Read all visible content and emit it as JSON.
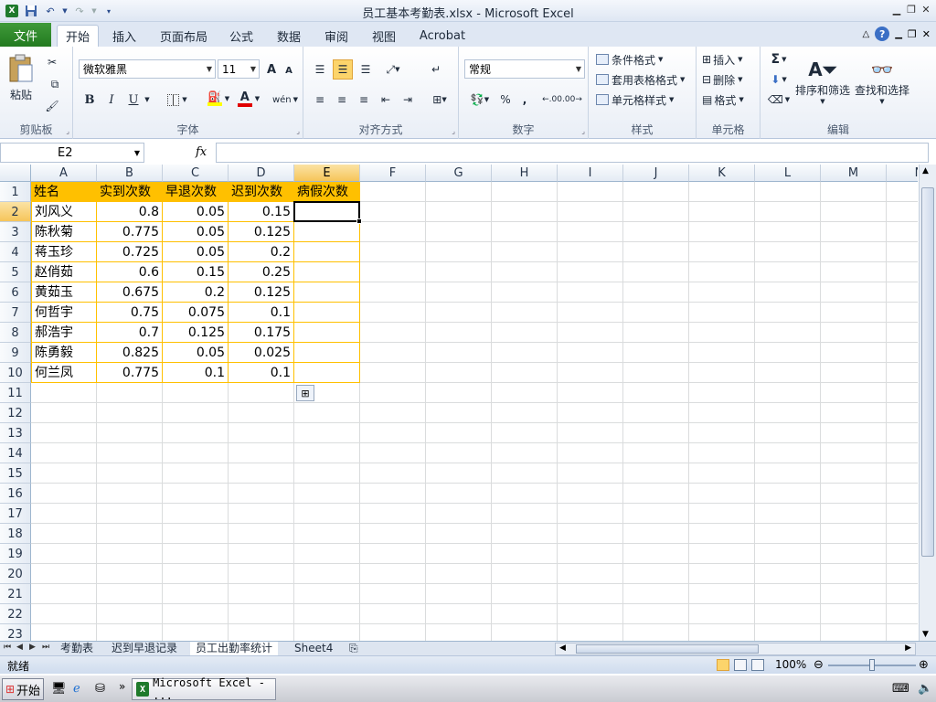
{
  "window": {
    "title": "员工基本考勤表.xlsx - Microsoft Excel"
  },
  "ribbon_tabs": [
    "文件",
    "开始",
    "插入",
    "页面布局",
    "公式",
    "数据",
    "审阅",
    "视图",
    "Acrobat"
  ],
  "ribbon": {
    "clipboard": {
      "paste": "粘贴",
      "group": "剪贴板"
    },
    "font": {
      "name": "微软雅黑",
      "size": "11",
      "bold": "B",
      "italic": "I",
      "underline": "U",
      "group": "字体",
      "grow": "A",
      "shrink": "A"
    },
    "alignment": {
      "group": "对齐方式"
    },
    "number": {
      "format": "常规",
      "percent": "%",
      "comma": ",",
      "inc_decimal": ".00",
      "dec_decimal": ".00",
      "group": "数字"
    },
    "styles": {
      "conditional": "条件格式",
      "table": "套用表格格式",
      "cell_styles": "单元格样式",
      "group": "样式"
    },
    "cells": {
      "insert": "插入",
      "delete": "删除",
      "format": "格式",
      "group": "单元格"
    },
    "editing": {
      "sum": "Σ",
      "sort": "排序和筛选",
      "find": "查找和选择",
      "group": "编辑"
    }
  },
  "formula_bar": {
    "name_box": "E2",
    "fx": "fx",
    "value": ""
  },
  "columns": [
    "A",
    "B",
    "C",
    "D",
    "E",
    "F",
    "G",
    "H",
    "I",
    "J",
    "K",
    "L",
    "M",
    "N"
  ],
  "rows": [
    "1",
    "2",
    "3",
    "4",
    "5",
    "6",
    "7",
    "8",
    "9",
    "10",
    "11",
    "12",
    "13",
    "14",
    "15",
    "16",
    "17",
    "18",
    "19",
    "20",
    "21",
    "22",
    "23"
  ],
  "table": {
    "headers": [
      "姓名",
      "实到次数",
      "早退次数",
      "迟到次数",
      "病假次数"
    ],
    "rows": [
      [
        "刘风义",
        "0.8",
        "0.05",
        "0.15",
        ""
      ],
      [
        "陈秋菊",
        "0.775",
        "0.05",
        "0.125",
        ""
      ],
      [
        "蒋玉珍",
        "0.725",
        "0.05",
        "0.2",
        ""
      ],
      [
        "赵俏茹",
        "0.6",
        "0.15",
        "0.25",
        ""
      ],
      [
        "黄茹玉",
        "0.675",
        "0.2",
        "0.125",
        ""
      ],
      [
        "何哲宇",
        "0.75",
        "0.075",
        "0.1",
        ""
      ],
      [
        "郝浩宇",
        "0.7",
        "0.125",
        "0.175",
        ""
      ],
      [
        "陈勇毅",
        "0.825",
        "0.05",
        "0.025",
        ""
      ],
      [
        "何兰凤",
        "0.775",
        "0.1",
        "0.1",
        ""
      ]
    ]
  },
  "active_cell": "E2",
  "sheets": [
    "考勤表",
    "迟到早退记录",
    "员工出勤率统计",
    "Sheet4"
  ],
  "active_sheet": "员工出勤率统计",
  "status": {
    "ready": "就绪",
    "zoom": "100%"
  },
  "taskbar": {
    "start": "开始",
    "app": "Microsoft Excel - ..."
  },
  "colors": {
    "header_fill": "#ffc000",
    "file_tab": "#2a8a25",
    "selection": "#000000"
  }
}
